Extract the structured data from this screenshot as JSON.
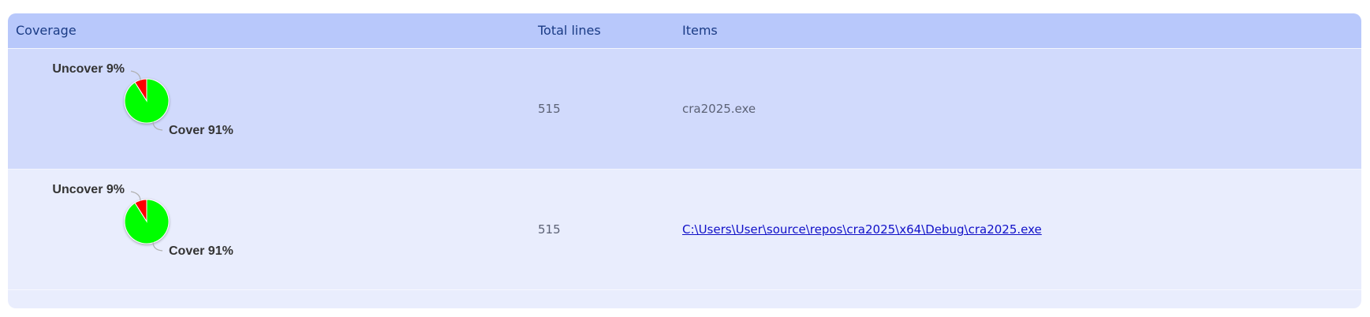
{
  "header": {
    "coverage": "Coverage",
    "total_lines": "Total lines",
    "items": "Items"
  },
  "rows": [
    {
      "total_lines": "515",
      "item": "cra2025.exe",
      "item_is_link": false,
      "chart_data": {
        "type": "pie",
        "slices": [
          {
            "label": "Uncover 9%",
            "value": 9,
            "color": "#ff0000"
          },
          {
            "label": "Cover 91%",
            "value": 91,
            "color": "#00ff00"
          }
        ]
      }
    },
    {
      "total_lines": "515",
      "item": "C:\\Users\\User\\source\\repos\\cra2025\\x64\\Debug\\cra2025.exe",
      "item_is_link": true,
      "chart_data": {
        "type": "pie",
        "slices": [
          {
            "label": "Uncover 9%",
            "value": 9,
            "color": "#ff0000"
          },
          {
            "label": "Cover 91%",
            "value": 91,
            "color": "#00ff00"
          }
        ]
      }
    }
  ]
}
